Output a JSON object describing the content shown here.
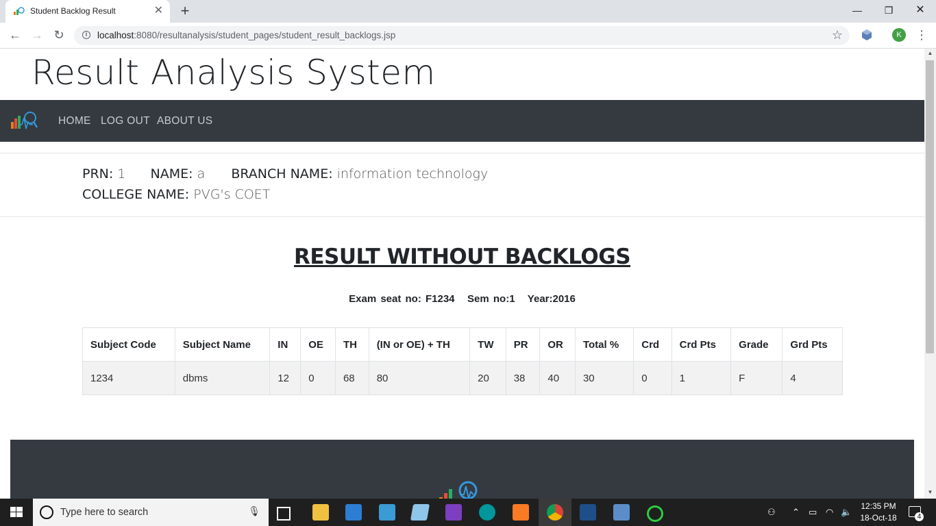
{
  "browser": {
    "tab_title": "Student Backlog Result",
    "new_tab_symbol": "+",
    "url_host": "localhost",
    "url_rest": ":8080/resultanalysis/student_pages/student_result_backlogs.jsp",
    "profile_initial": "K"
  },
  "site": {
    "title": "Result Analysis System",
    "nav": [
      "HOME",
      "LOG OUT",
      "ABOUT US"
    ]
  },
  "student": {
    "prn_label": "PRN:",
    "prn_value": "1",
    "name_label": "NAME:",
    "name_value": "a",
    "branch_label": "BRANCH NAME:",
    "branch_value": "information technology",
    "college_label": "COLLEGE NAME:",
    "college_value": "PVG's COET"
  },
  "result": {
    "heading": "RESULT WITHOUT BACKLOGS",
    "exam_seat": "Exam seat no: F1234",
    "sem_no": "Sem no:1",
    "year": "Year:2016",
    "columns": [
      "Subject Code",
      "Subject Name",
      "IN",
      "OE",
      "TH",
      "(IN or OE) + TH",
      "TW",
      "PR",
      "OR",
      "Total %",
      "Crd",
      "Crd Pts",
      "Grade",
      "Grd Pts"
    ],
    "rows": [
      [
        "1234",
        "dbms",
        "12",
        "0",
        "68",
        "80",
        "20",
        "38",
        "40",
        "30",
        "0",
        "1",
        "F",
        "4"
      ]
    ]
  },
  "taskbar": {
    "search_placeholder": "Type here to search",
    "time": "12:35 PM",
    "date": "18-Oct-18",
    "notification_count": "4"
  },
  "colors": {
    "navbar": "#343a40",
    "nav_link": "#c8cbcf",
    "taskbar": "#1f1f1f"
  }
}
